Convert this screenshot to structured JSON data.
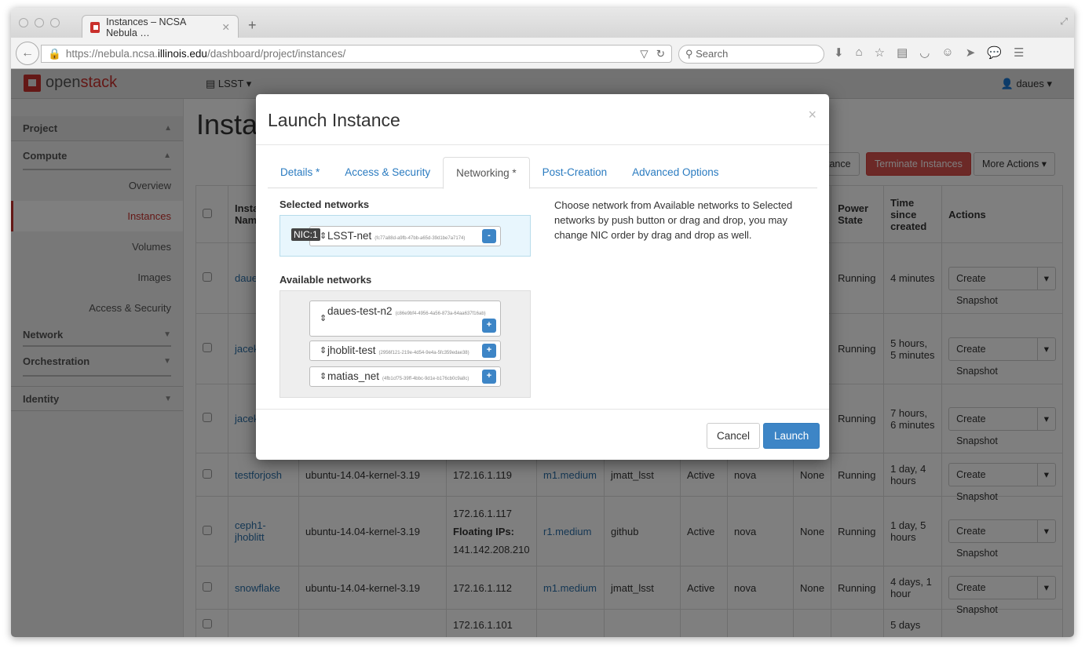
{
  "browser": {
    "tab_title": "Instances – NCSA Nebula …",
    "url_pre": "https://nebula.ncsa.",
    "url_host": "illinois.edu",
    "url_path": "/dashboard/project/instances/",
    "search_placeholder": "Search"
  },
  "header": {
    "logo_open": "open",
    "logo_stack": "stack",
    "project": "LSST",
    "user": "daues"
  },
  "sidebar": {
    "project": "Project",
    "compute": "Compute",
    "items": [
      "Overview",
      "Instances",
      "Volumes",
      "Images",
      "Access & Security"
    ],
    "network": "Network",
    "orchestration": "Orchestration",
    "identity": "Identity"
  },
  "page": {
    "title": "Instances",
    "launch_partial": "tance",
    "terminate": "Terminate Instances",
    "more": "More Actions"
  },
  "table": {
    "headers": {
      "name": "Instance Name",
      "power": "Power State",
      "time": "Time since created",
      "actions": "Actions"
    },
    "rows": [
      {
        "name": "daues-stack",
        "image": "",
        "ip": "",
        "floating_label": "",
        "floating_ip": "",
        "size": "",
        "key": "",
        "status": "",
        "az": "",
        "task": "",
        "power": "Running",
        "time": "4 minutes"
      },
      {
        "name": "jacek",
        "image": "",
        "ip": "",
        "floating_label": "",
        "floating_ip": "",
        "size": "",
        "key": "",
        "status": "",
        "az": "",
        "task": "",
        "power": "Running",
        "time": "5 hours, 5 minutes"
      },
      {
        "name": "jacek",
        "image": "",
        "ip": "",
        "floating_label": "",
        "floating_ip": "",
        "size": "",
        "key": "",
        "status": "",
        "az": "",
        "task": "",
        "power": "Running",
        "time": "7 hours, 6 minutes"
      },
      {
        "name": "testforjosh",
        "image": "ubuntu-14.04-kernel-3.19",
        "ip": "172.16.1.119",
        "floating_label": "",
        "floating_ip": "",
        "size": "m1.medium",
        "key": "jmatt_lsst",
        "status": "Active",
        "az": "nova",
        "task": "None",
        "power": "Running",
        "time": "1 day, 4 hours"
      },
      {
        "name": "ceph1-jhoblitt",
        "image": "ubuntu-14.04-kernel-3.19",
        "ip": "172.16.1.117",
        "floating_label": "Floating IPs:",
        "floating_ip": "141.142.208.210",
        "size": "r1.medium",
        "key": "github",
        "status": "Active",
        "az": "nova",
        "task": "None",
        "power": "Running",
        "time": "1 day, 5 hours"
      },
      {
        "name": "snowflake",
        "image": "ubuntu-14.04-kernel-3.19",
        "ip": "172.16.1.112",
        "floating_label": "",
        "floating_ip": "",
        "size": "m1.medium",
        "key": "jmatt_lsst",
        "status": "Active",
        "az": "nova",
        "task": "None",
        "power": "Running",
        "time": "4 days, 1 hour"
      },
      {
        "name": "",
        "image": "",
        "ip": "172.16.1.101",
        "floating_label": "",
        "floating_ip": "",
        "size": "",
        "key": "",
        "status": "",
        "az": "",
        "task": "",
        "power": "",
        "time": "5 days"
      }
    ],
    "snapshot": "Create Snapshot"
  },
  "modal": {
    "title": "Launch Instance",
    "close": "×",
    "tabs": [
      "Details *",
      "Access & Security",
      "Networking *",
      "Post-Creation",
      "Advanced Options"
    ],
    "selected_label": "Selected networks",
    "available_label": "Available networks",
    "nic": "NIC:1",
    "selected": [
      {
        "name": "LSST-net",
        "id": "(fc77a88d-a9fb-47bb-a65d-39d1be7a7174)"
      }
    ],
    "available": [
      {
        "name": "daues-test-n2",
        "id": "(c86e9bf4-4956-4a56-873a-64aa637f16ab)"
      },
      {
        "name": "jhoblit-test",
        "id": "(2956f121-219e-4d54-9e4a-5fc359edae38)"
      },
      {
        "name": "matias_net",
        "id": "(4fb1cf75-39ff-4bbc-9d1e-b176cb0c9a8c)"
      }
    ],
    "help": "Choose network from Available networks to Selected networks by push button or drag and drop, you may change NIC order by drag and drop as well.",
    "cancel": "Cancel",
    "launch": "Launch"
  }
}
